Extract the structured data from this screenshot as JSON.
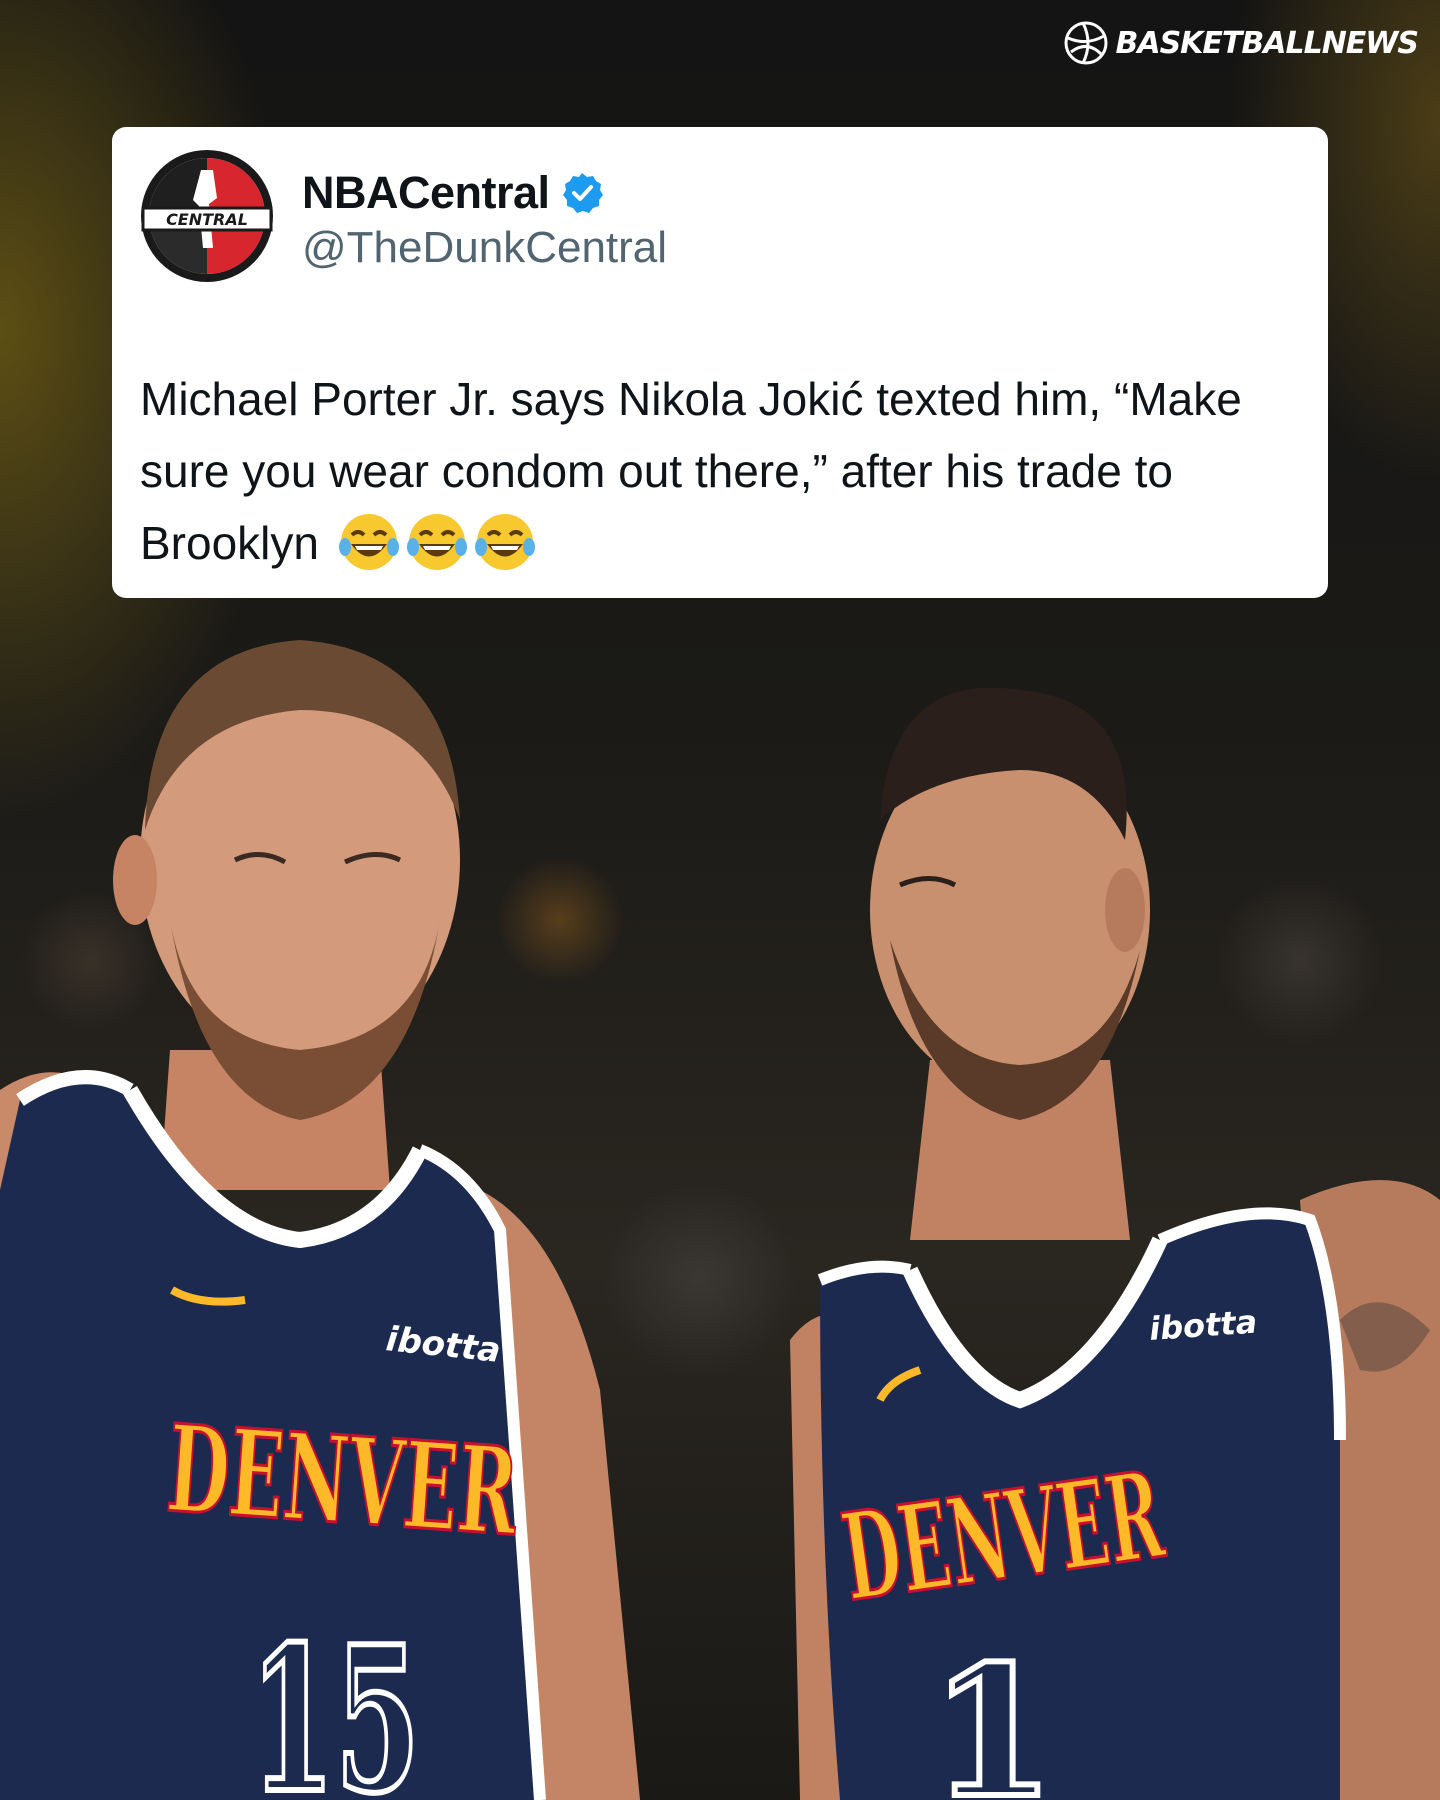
{
  "brand": {
    "name": "BASKETBALLNEWS",
    "icon": "basketball-icon"
  },
  "tweet": {
    "author_name": "NBACentral",
    "handle": "@TheDunkCentral",
    "avatar_text": "CENTRAL",
    "verified_icon": "verified-badge-icon",
    "text": "Michael Porter Jr. says Nikola Jokić texted him, “Make sure you wear condom out there,” after his trade to Brooklyn",
    "emojis": [
      "😂",
      "😂",
      "😂"
    ]
  },
  "photo": {
    "player_left": {
      "team": "DENVER",
      "number": "15",
      "sponsor": "ibotta"
    },
    "player_right": {
      "team": "DENVER",
      "number": "1",
      "sponsor": "ibotta"
    }
  },
  "colors": {
    "jersey_navy": "#1d2a4f",
    "jersey_gold": "#fdb927",
    "jersey_red": "#c8102e",
    "verified_blue": "#1d9bf0"
  }
}
